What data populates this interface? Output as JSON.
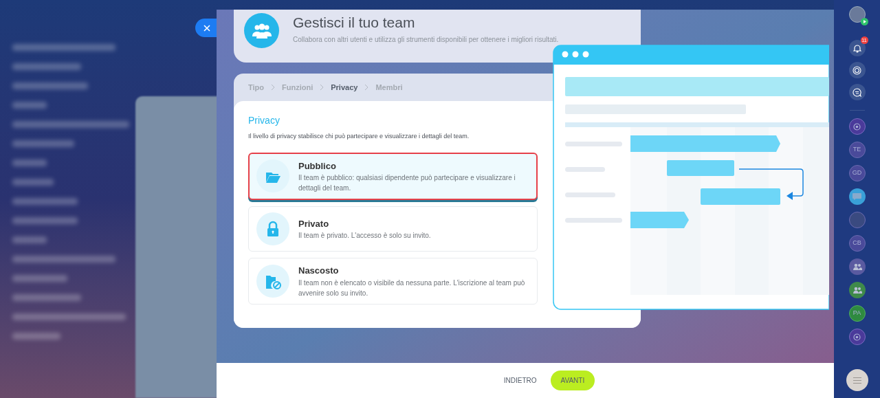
{
  "header": {
    "title": "Gestisci il tuo team",
    "subtitle": "Collabora con altri utenti e utilizza gli strumenti disponibili per ottenere i migliori risultati."
  },
  "steps": [
    {
      "label": "Tipo",
      "selected": false
    },
    {
      "label": "Funzioni",
      "selected": false
    },
    {
      "label": "Privacy",
      "selected": true
    },
    {
      "label": "Membri",
      "selected": false
    }
  ],
  "section": {
    "title": "Privacy",
    "description": "Il livello di privacy stabilisce chi può partecipare e visualizzare i dettagli del team."
  },
  "options": [
    {
      "kind": "folder",
      "title": "Pubblico",
      "description": "Il team è pubblico: qualsiasi dipendente può partecipare e visualizzare i dettagli del team.",
      "selected": true
    },
    {
      "kind": "lock",
      "title": "Privato",
      "description": "Il team è privato. L'accesso è solo su invito.",
      "selected": false
    },
    {
      "kind": "hidden",
      "title": "Nascosto",
      "description": "Il team non è elencato o visibile da nessuna parte. L'iscrizione al team può avvenire solo su invito.",
      "selected": false
    }
  ],
  "footer": {
    "back": "INDIETRO",
    "next": "AVANTI"
  },
  "right_rail": {
    "notification_count": "11",
    "chats": [
      {
        "kind": "icon"
      },
      {
        "kind": "initials",
        "text": "TE"
      },
      {
        "kind": "initials",
        "text": "GD"
      },
      {
        "kind": "chat"
      },
      {
        "kind": "photo"
      },
      {
        "kind": "initials",
        "text": "CB"
      },
      {
        "kind": "group"
      },
      {
        "kind": "group_green"
      },
      {
        "kind": "initials_green",
        "text": "PA"
      },
      {
        "kind": "icon"
      }
    ]
  }
}
